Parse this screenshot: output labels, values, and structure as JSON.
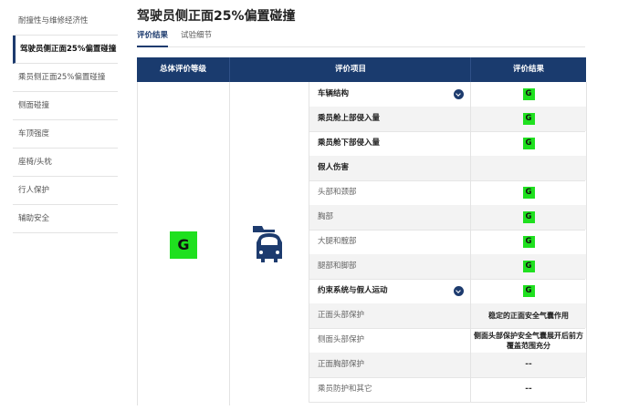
{
  "sidebar": {
    "items": [
      {
        "label": "耐撞性与维修经济性",
        "active": false
      },
      {
        "label": "驾驶员侧正面25%偏置碰撞",
        "active": true
      },
      {
        "label": "乘员侧正面25%偏置碰撞",
        "active": false
      },
      {
        "label": "侧面碰撞",
        "active": false
      },
      {
        "label": "车顶强度",
        "active": false
      },
      {
        "label": "座椅/头枕",
        "active": false
      },
      {
        "label": "行人保护",
        "active": false
      },
      {
        "label": "辅助安全",
        "active": false
      }
    ]
  },
  "page": {
    "title": "驾驶员侧正面25%偏置碰撞"
  },
  "tabs": [
    {
      "label": "评价结果",
      "active": true
    },
    {
      "label": "试验细节",
      "active": false
    }
  ],
  "table": {
    "headers": {
      "overall": "总体评价等级",
      "item": "评价项目",
      "result": "评价结果"
    },
    "overall_grade": "G",
    "icons": {
      "car": "car-front-crash-icon",
      "chevron": "chevron-down-icon"
    },
    "colors": {
      "header": "#1a3b6e",
      "grade_good": "#1fe01f"
    },
    "rows": [
      {
        "label": "车辆结构",
        "bold": true,
        "expand": true,
        "grade": "G"
      },
      {
        "label": "乘员舱上部侵入量",
        "bold": true,
        "grade": "G"
      },
      {
        "label": "乘员舱下部侵入量",
        "bold": true,
        "grade": "G"
      },
      {
        "label": "假人伤害",
        "bold": true
      },
      {
        "label": "头部和颈部",
        "grade": "G"
      },
      {
        "label": "胸部",
        "grade": "G"
      },
      {
        "label": "大腿和髋部",
        "grade": "G"
      },
      {
        "label": "腿部和脚部",
        "grade": "G"
      },
      {
        "label": "约束系统与假人运动",
        "bold": true,
        "expand": true,
        "grade": "G"
      },
      {
        "label": "正面头部保护",
        "text": "稳定的正面安全气囊作用"
      },
      {
        "label": "侧面头部保护",
        "text": "侧面头部保护安全气囊展开后前方覆盖范围充分"
      },
      {
        "label": "正面胸部保护",
        "text": "--"
      },
      {
        "label": "乘员防护和其它",
        "text": "--"
      }
    ]
  }
}
